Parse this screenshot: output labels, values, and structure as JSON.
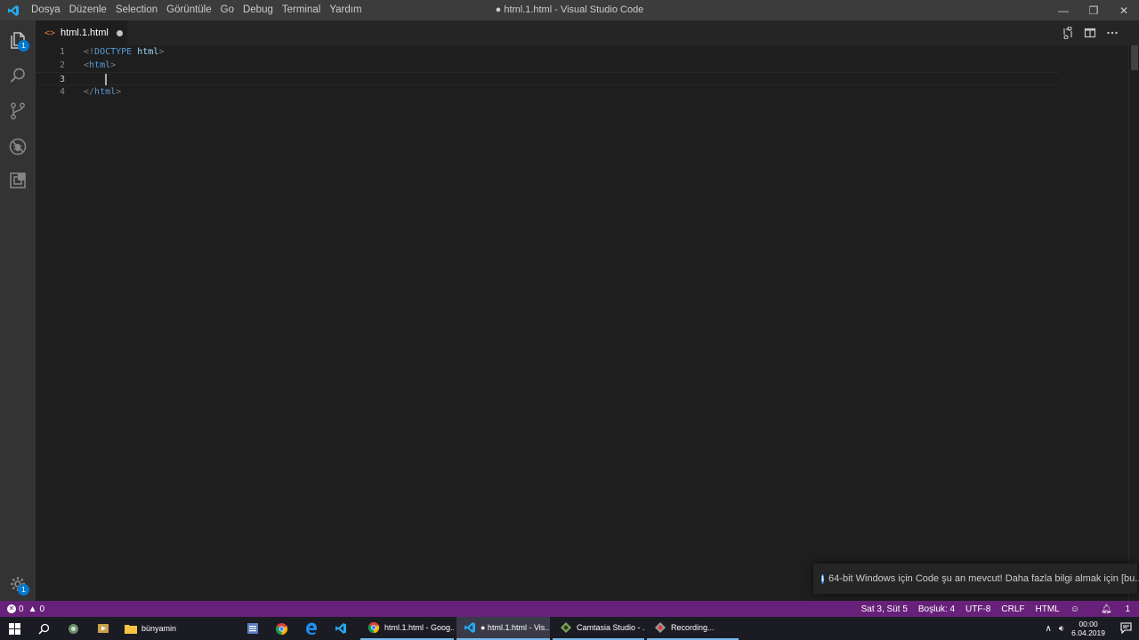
{
  "window": {
    "title": "● html.1.html - Visual Studio Code",
    "menu": [
      "Dosya",
      "Düzenle",
      "Selection",
      "Görüntüle",
      "Go",
      "Debug",
      "Terminal",
      "Yardım"
    ],
    "controls": {
      "minimize": "—",
      "maximize": "❐",
      "close": "✕"
    }
  },
  "activity_bar": {
    "items": [
      {
        "name": "explorer",
        "icon": "files-icon",
        "badge": "1"
      },
      {
        "name": "search",
        "icon": "search-icon"
      },
      {
        "name": "source-control",
        "icon": "source-control-icon"
      },
      {
        "name": "debug",
        "icon": "debug-icon"
      },
      {
        "name": "extensions",
        "icon": "extensions-icon"
      }
    ],
    "manage": {
      "icon": "gear-icon",
      "badge": "1"
    }
  },
  "tabs": [
    {
      "label": "html.1.html",
      "icon": "html-file-icon",
      "dirty": true,
      "active": true
    }
  ],
  "editor": {
    "line_numbers": [
      "1",
      "2",
      "3",
      "4"
    ],
    "lines": {
      "l1_open": "<!",
      "l1_doctype": "DOCTYPE",
      "l1_space": " ",
      "l1_html": "html",
      "l1_close": ">",
      "l2_open": "<",
      "l2_tag": "html",
      "l2_close": ">",
      "l4_open": "</",
      "l4_tag": "html",
      "l4_close": ">"
    },
    "cursor": {
      "line": 3
    }
  },
  "notification": {
    "icon": "info-icon",
    "text": "64-bit Windows için Code şu an mevcut! Daha fazla bilgi almak için [bu..."
  },
  "status_bar": {
    "errors": "0",
    "warnings": "0",
    "position": "Sat 3, Süt 5",
    "indent": "Boşluk: 4",
    "encoding": "UTF-8",
    "eol": "CRLF",
    "language": "HTML",
    "feedback_icon": "smiley-icon",
    "notifications": "1"
  },
  "taskbar": {
    "pinned": [
      {
        "icon": "windows-start-icon"
      },
      {
        "icon": "search-icon"
      },
      {
        "icon": "cortana-icon"
      },
      {
        "icon": "media-icon"
      }
    ],
    "apps": [
      {
        "label": "bünyamin",
        "icon": "folder-icon",
        "state": "plain"
      },
      {
        "label": "",
        "icon": "word-icon",
        "state": "plain"
      },
      {
        "label": "",
        "icon": "chrome-icon",
        "state": "plain"
      },
      {
        "label": "",
        "icon": "edge-icon",
        "state": "plain"
      },
      {
        "label": "",
        "icon": "vscode-icon",
        "state": "plain"
      },
      {
        "label": "html.1.html - Goog...",
        "icon": "chrome-icon",
        "state": "running"
      },
      {
        "label": "● html.1.html - Vis...",
        "icon": "vscode-icon",
        "state": "active"
      },
      {
        "label": "Camtasia Studio - ...",
        "icon": "camtasia-icon",
        "state": "running"
      },
      {
        "label": "Recording...",
        "icon": "recorder-icon",
        "state": "running"
      }
    ],
    "tray": {
      "time": "00:00",
      "date": "6.04.2019"
    }
  },
  "colors": {
    "status_bar": "#68217a",
    "editor_bg": "#1e1e1e",
    "activity_bar": "#333333",
    "accent": "#007acc"
  }
}
